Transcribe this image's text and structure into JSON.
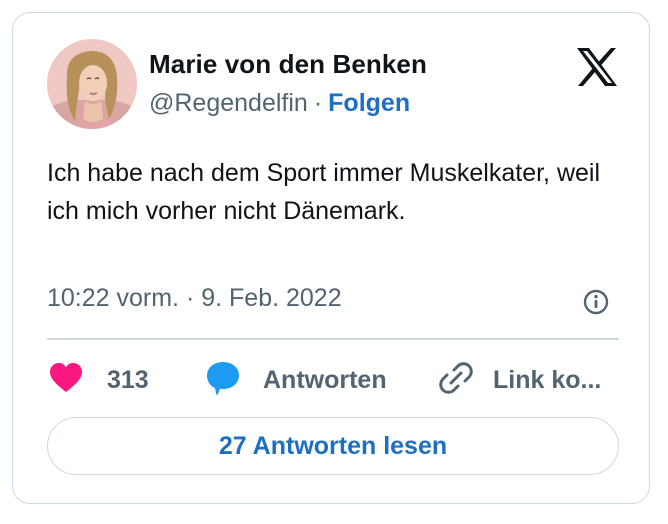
{
  "author": {
    "name": "Marie von den Benken",
    "handle": "@Regendelfin",
    "separator": "·",
    "follow_label": "Folgen"
  },
  "tweet": {
    "text": "Ich habe nach dem Sport immer Muskelkater, weil ich mich vorher nicht Dänemark.",
    "timestamp": "10:22 vorm. · 9. Feb. 2022"
  },
  "actions": {
    "likes_count": "313",
    "reply_label": "Antworten",
    "copy_link_label": "Link ko..."
  },
  "read_replies_label": "27 Antworten lesen",
  "icons": {
    "like": "heart-icon",
    "reply": "speech-bubble-icon",
    "copy": "link-icon",
    "info": "info-icon",
    "brand": "x-logo-icon"
  },
  "colors": {
    "like": "#f91880",
    "reply": "#1d9bf0",
    "accent": "#1d6fc4",
    "secondary_text": "#536471",
    "border": "#cfd9de"
  }
}
